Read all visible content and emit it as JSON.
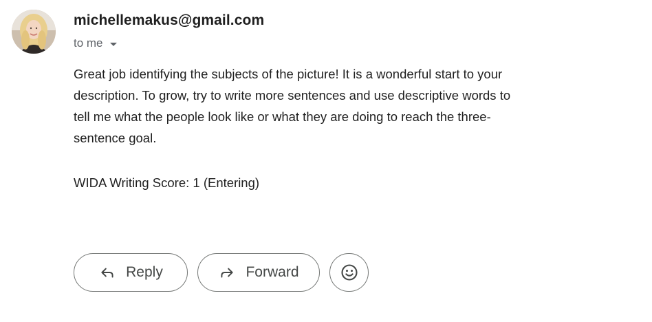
{
  "message": {
    "sender": "michellemakus@gmail.com",
    "recipient_label": "to me",
    "recipient_caret_icon": "caret-down-icon",
    "avatar_icon": "sender-avatar",
    "body": "Great job identifying the subjects of the picture! It is a wonderful start to your description. To grow, try to write more sentences and use descriptive words to tell me what the people look like or what they are doing to reach the three-sentence goal.",
    "score_line": "WIDA Writing Score: 1 (Entering)"
  },
  "actions": {
    "reply_label": "Reply",
    "reply_icon": "reply-arrow-icon",
    "forward_label": "Forward",
    "forward_icon": "forward-arrow-icon",
    "emoji_icon": "smiley-face-icon"
  },
  "colors": {
    "text": "#1f1f1f",
    "secondary_text": "#5f6368",
    "button_border": "#747775",
    "button_text": "#444746",
    "background": "#ffffff"
  }
}
